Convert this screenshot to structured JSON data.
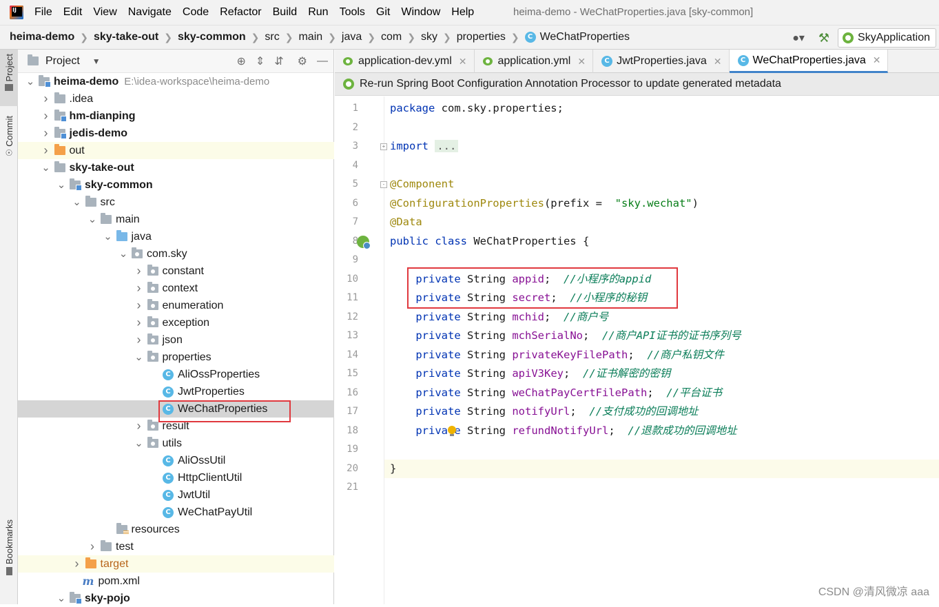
{
  "menubar": {
    "items": [
      "File",
      "Edit",
      "View",
      "Navigate",
      "Code",
      "Refactor",
      "Build",
      "Run",
      "Tools",
      "Git",
      "Window",
      "Help"
    ],
    "window_title": "heima-demo - WeChatProperties.java [sky-common]"
  },
  "navbar": {
    "crumbs": [
      "heima-demo",
      "sky-take-out",
      "sky-common",
      "src",
      "main",
      "java",
      "com",
      "sky",
      "properties",
      "WeChatProperties"
    ],
    "run_config": "SkyApplication"
  },
  "toolstrip": {
    "project_label": "Project",
    "commit_label": "Commit",
    "bookmarks_label": "Bookmarks"
  },
  "project_panel": {
    "title": "Project",
    "tree": [
      {
        "label": "heima-demo",
        "path": "E:\\idea-workspace\\heima-demo",
        "depth": 0,
        "arrow": "open",
        "icon": "module",
        "bold": true
      },
      {
        "label": ".idea",
        "depth": 1,
        "arrow": "closed",
        "icon": "folder"
      },
      {
        "label": "hm-dianping",
        "depth": 1,
        "arrow": "closed",
        "icon": "module",
        "bold": true
      },
      {
        "label": "jedis-demo",
        "depth": 1,
        "arrow": "closed",
        "icon": "module",
        "bold": true
      },
      {
        "label": "out",
        "depth": 1,
        "arrow": "closed",
        "icon": "orange",
        "highlight": true
      },
      {
        "label": "sky-take-out",
        "depth": 1,
        "arrow": "open",
        "icon": "folder",
        "bold": true
      },
      {
        "label": "sky-common",
        "depth": 2,
        "arrow": "open",
        "icon": "module",
        "bold": true
      },
      {
        "label": "src",
        "depth": 3,
        "arrow": "open",
        "icon": "folder"
      },
      {
        "label": "main",
        "depth": 4,
        "arrow": "open",
        "icon": "folder"
      },
      {
        "label": "java",
        "depth": 5,
        "arrow": "open",
        "icon": "blue"
      },
      {
        "label": "com.sky",
        "depth": 6,
        "arrow": "open",
        "icon": "pkg"
      },
      {
        "label": "constant",
        "depth": 7,
        "arrow": "closed",
        "icon": "pkg"
      },
      {
        "label": "context",
        "depth": 7,
        "arrow": "closed",
        "icon": "pkg"
      },
      {
        "label": "enumeration",
        "depth": 7,
        "arrow": "closed",
        "icon": "pkg"
      },
      {
        "label": "exception",
        "depth": 7,
        "arrow": "closed",
        "icon": "pkg"
      },
      {
        "label": "json",
        "depth": 7,
        "arrow": "closed",
        "icon": "pkg"
      },
      {
        "label": "properties",
        "depth": 7,
        "arrow": "open",
        "icon": "pkg"
      },
      {
        "label": "AliOssProperties",
        "depth": 8,
        "arrow": "none",
        "icon": "class"
      },
      {
        "label": "JwtProperties",
        "depth": 8,
        "arrow": "none",
        "icon": "class"
      },
      {
        "label": "WeChatProperties",
        "depth": 8,
        "arrow": "none",
        "icon": "class",
        "selected": true
      },
      {
        "label": "result",
        "depth": 7,
        "arrow": "closed",
        "icon": "pkg"
      },
      {
        "label": "utils",
        "depth": 7,
        "arrow": "open",
        "icon": "pkg"
      },
      {
        "label": "AliOssUtil",
        "depth": 8,
        "arrow": "none",
        "icon": "class"
      },
      {
        "label": "HttpClientUtil",
        "depth": 8,
        "arrow": "none",
        "icon": "class"
      },
      {
        "label": "JwtUtil",
        "depth": 8,
        "arrow": "none",
        "icon": "class"
      },
      {
        "label": "WeChatPayUtil",
        "depth": 8,
        "arrow": "none",
        "icon": "class"
      },
      {
        "label": "resources",
        "depth": 5,
        "arrow": "none",
        "icon": "res"
      },
      {
        "label": "test",
        "depth": 4,
        "arrow": "closed",
        "icon": "folder"
      },
      {
        "label": "target",
        "depth": 3,
        "arrow": "closed",
        "icon": "orange",
        "highlight": true,
        "orange_text": true
      },
      {
        "label": "pom.xml",
        "depth": 3,
        "arrow": "none",
        "icon": "maven"
      },
      {
        "label": "sky-pojo",
        "depth": 2,
        "arrow": "open",
        "icon": "module",
        "bold": true
      }
    ]
  },
  "editor": {
    "tabs": [
      {
        "label": "application-dev.yml",
        "icon": "yml"
      },
      {
        "label": "application.yml",
        "icon": "yml"
      },
      {
        "label": "JwtProperties.java",
        "icon": "class"
      },
      {
        "label": "WeChatProperties.java",
        "icon": "class",
        "active": true
      }
    ],
    "banner": "Re-run Spring Boot Configuration Annotation Processor to update generated metadata",
    "lines": [
      {
        "n": "1",
        "tokens": [
          [
            "kw",
            "package"
          ],
          [
            "",
            "com.sky.properties;"
          ]
        ]
      },
      {
        "n": "2",
        "tokens": []
      },
      {
        "n": "3",
        "tokens": [
          [
            "kw",
            "import"
          ],
          [
            "",
            ""
          ],
          [
            "dots",
            "..."
          ]
        ]
      },
      {
        "n": "4",
        "tokens": []
      },
      {
        "n": "5",
        "tokens": [
          [
            "ann",
            "@Component"
          ]
        ]
      },
      {
        "n": "6",
        "tokens": [
          [
            "ann",
            "@ConfigurationProperties"
          ],
          [
            "",
            "(prefix = "
          ],
          [
            "str",
            "\"sky.wechat\""
          ],
          [
            "",
            ")"
          ]
        ]
      },
      {
        "n": "7",
        "tokens": [
          [
            "ann",
            "@Data"
          ]
        ]
      },
      {
        "n": "8",
        "tokens": [
          [
            "kw",
            "public class"
          ],
          [
            "",
            "WeChatProperties {"
          ]
        ]
      },
      {
        "n": "9",
        "tokens": []
      },
      {
        "n": "10",
        "tokens": [
          [
            "kw",
            "    private"
          ],
          [
            "",
            "String"
          ],
          [
            "field",
            "appid"
          ],
          [
            "",
            ";"
          ],
          [
            "cmtd",
            "//小程序的appid"
          ]
        ]
      },
      {
        "n": "11",
        "tokens": [
          [
            "kw",
            "    private"
          ],
          [
            "",
            "String"
          ],
          [
            "field",
            "secret"
          ],
          [
            "",
            ";"
          ],
          [
            "cmtd",
            "//小程序的秘钥"
          ]
        ]
      },
      {
        "n": "12",
        "tokens": [
          [
            "kw",
            "    private"
          ],
          [
            "",
            "String"
          ],
          [
            "field",
            "mchid"
          ],
          [
            "",
            ";"
          ],
          [
            "cmtd",
            "//商户号"
          ]
        ]
      },
      {
        "n": "13",
        "tokens": [
          [
            "kw",
            "    private"
          ],
          [
            "",
            "String"
          ],
          [
            "field",
            "mchSerialNo"
          ],
          [
            "",
            ";"
          ],
          [
            "cmtd",
            "//商户API证书的证书序列号"
          ]
        ]
      },
      {
        "n": "14",
        "tokens": [
          [
            "kw",
            "    private"
          ],
          [
            "",
            "String"
          ],
          [
            "field",
            "privateKeyFilePath"
          ],
          [
            "",
            ";"
          ],
          [
            "cmtd",
            "//商户私钥文件"
          ]
        ]
      },
      {
        "n": "15",
        "tokens": [
          [
            "kw",
            "    private"
          ],
          [
            "",
            "String"
          ],
          [
            "field",
            "apiV3Key"
          ],
          [
            "",
            ";"
          ],
          [
            "cmtd",
            "//证书解密的密钥"
          ]
        ]
      },
      {
        "n": "16",
        "tokens": [
          [
            "kw",
            "    private"
          ],
          [
            "",
            "String"
          ],
          [
            "field",
            "weChatPayCertFilePath"
          ],
          [
            "",
            ";"
          ],
          [
            "cmtd",
            "//平台证书"
          ]
        ]
      },
      {
        "n": "17",
        "tokens": [
          [
            "kw",
            "    private"
          ],
          [
            "",
            "String"
          ],
          [
            "field",
            "notifyUrl"
          ],
          [
            "",
            ";"
          ],
          [
            "cmtd",
            "//支付成功的回调地址"
          ]
        ]
      },
      {
        "n": "18",
        "tokens": [
          [
            "kw",
            "    private"
          ],
          [
            "",
            "String"
          ],
          [
            "field",
            "refundNotifyUrl"
          ],
          [
            "",
            ";"
          ],
          [
            "cmtd",
            "//退款成功的回调地址"
          ]
        ]
      },
      {
        "n": "19",
        "tokens": []
      },
      {
        "n": "20",
        "tokens": [
          [
            "",
            "}"
          ]
        ]
      },
      {
        "n": "21",
        "tokens": []
      }
    ]
  },
  "watermark": "CSDN @清风微凉 aaa"
}
